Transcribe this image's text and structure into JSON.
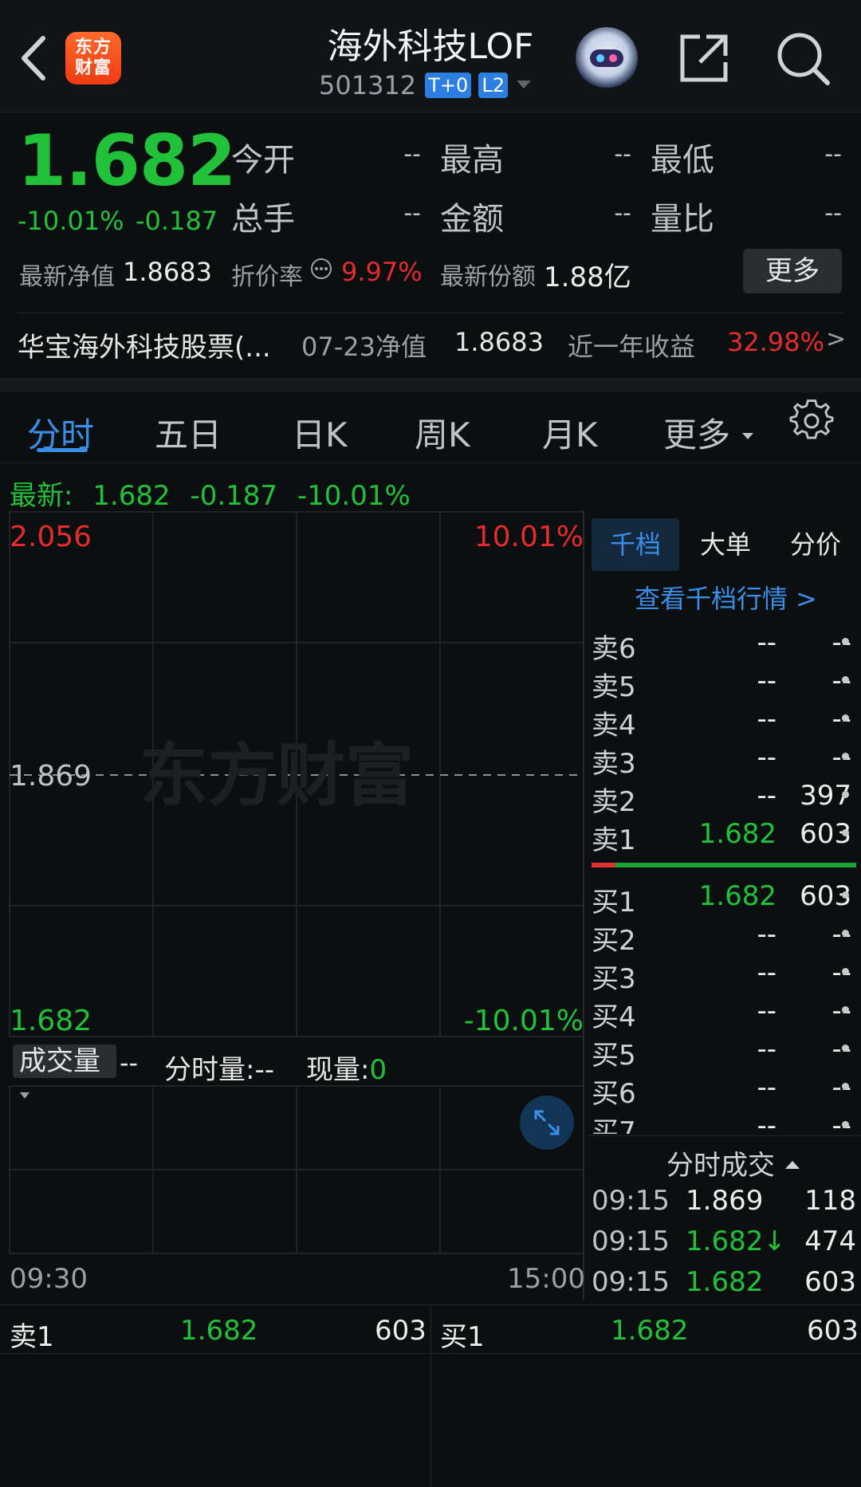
{
  "header": {
    "logo_text_line1": "东方",
    "logo_text_line2": "财富",
    "title": "海外科技LOF",
    "code": "501312",
    "tags": [
      "T+0",
      "L2"
    ]
  },
  "quote": {
    "price": "1.682",
    "change_pct": "-10.01%",
    "change_abs": "-0.187",
    "fields": [
      {
        "label": "今开",
        "value": "--"
      },
      {
        "label": "最高",
        "value": "--"
      },
      {
        "label": "最低",
        "value": "--"
      },
      {
        "label": "总手",
        "value": "--"
      },
      {
        "label": "金额",
        "value": "--"
      },
      {
        "label": "量比",
        "value": "--"
      }
    ],
    "nav_label": "最新净值",
    "nav_value": "1.8683",
    "discount_label": "折价率",
    "discount_value": "9.97%",
    "shares_label": "最新份额",
    "shares_value": "1.88亿",
    "more_label": "更多"
  },
  "fund": {
    "name": "华宝海外科技股票(...",
    "date_label": "07-23净值",
    "nav": "1.8683",
    "year_label": "近一年收益",
    "year_return": "32.98%",
    "arrow": ">"
  },
  "tabs": [
    "分时",
    "五日",
    "日K",
    "周K",
    "月K",
    "更多"
  ],
  "latest": {
    "label": "最新:",
    "price": "1.682",
    "change": "-0.187",
    "pct": "-10.01%"
  },
  "chart": {
    "y_top": "2.056",
    "y_mid": "1.869",
    "y_bottom": "1.682",
    "pct_top": "10.01%",
    "pct_bottom": "-10.01%",
    "watermark": "东方财富",
    "volume_dropdown": "成交量",
    "volume_value": "--",
    "fsl_label": "分时量:",
    "fsl_value": "--",
    "xl_label": "现量:",
    "xl_value": "0",
    "time_start": "09:30",
    "time_end": "15:00"
  },
  "orderbook": {
    "tabs": [
      "千档",
      "大单",
      "分价"
    ],
    "link": "查看千档行情 >",
    "asks": [
      {
        "label": "卖6",
        "price": "--",
        "qty": "--"
      },
      {
        "label": "卖5",
        "price": "--",
        "qty": "--"
      },
      {
        "label": "卖4",
        "price": "--",
        "qty": "--"
      },
      {
        "label": "卖3",
        "price": "--",
        "qty": "--"
      },
      {
        "label": "卖2",
        "price": "--",
        "qty": "397"
      },
      {
        "label": "卖1",
        "price": "1.682",
        "qty": "603"
      }
    ],
    "bids": [
      {
        "label": "买1",
        "price": "1.682",
        "qty": "603"
      },
      {
        "label": "买2",
        "price": "--",
        "qty": "--"
      },
      {
        "label": "买3",
        "price": "--",
        "qty": "--"
      },
      {
        "label": "买4",
        "price": "--",
        "qty": "--"
      },
      {
        "label": "买5",
        "price": "--",
        "qty": "--"
      },
      {
        "label": "买6",
        "price": "--",
        "qty": "--"
      },
      {
        "label": "买7",
        "price": "--",
        "qty": "--"
      }
    ]
  },
  "ticks": {
    "title": "分时成交",
    "rows": [
      {
        "time": "09:15",
        "price": "1.869",
        "vol": "118"
      },
      {
        "time": "09:15",
        "price": "1.682↓",
        "vol": "474"
      },
      {
        "time": "09:15",
        "price": "1.682",
        "vol": "603"
      }
    ]
  },
  "bottom": {
    "sell_label": "卖1",
    "sell_price": "1.682",
    "sell_qty": "603",
    "buy_label": "买1",
    "buy_price": "1.682",
    "buy_qty": "603"
  }
}
